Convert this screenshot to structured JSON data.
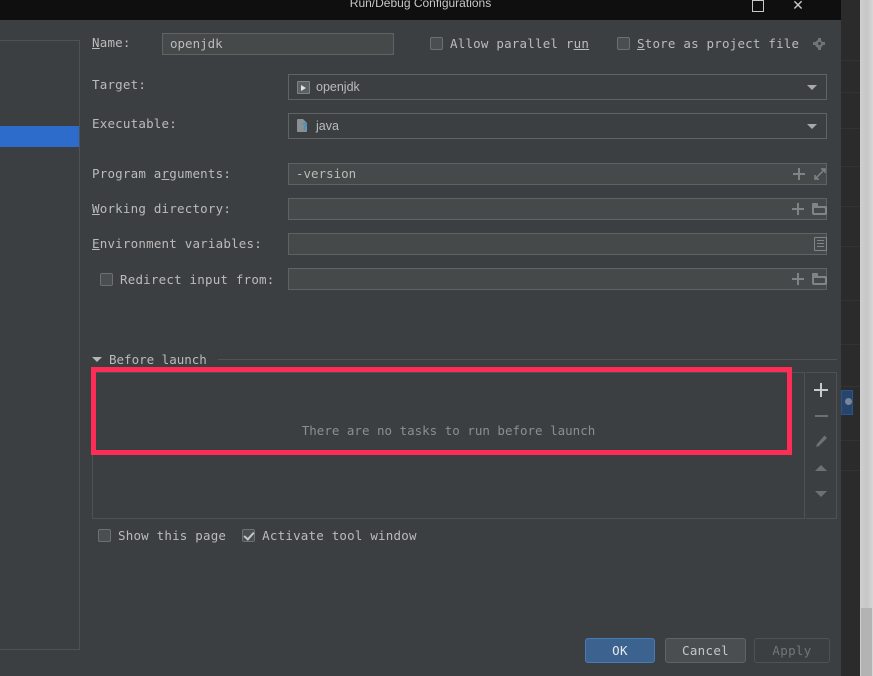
{
  "window": {
    "title": "Run/Debug Configurations",
    "maximize_label": "",
    "close_label": "✕"
  },
  "form": {
    "name": {
      "label": "Name:",
      "label_mnemonic": "N",
      "label_rest": "ame:",
      "value": "openjdk"
    },
    "allow_parallel_run": {
      "label_pre": "Allow parallel r",
      "label_mnemonic": "un",
      "label_post": "",
      "checked": false
    },
    "store_as_project_file": {
      "label_mnemonic": "S",
      "label_rest": "tore as project file",
      "checked": false
    },
    "target": {
      "label": "Target:",
      "value": "openjdk",
      "icon": "target-console-icon"
    },
    "executable": {
      "label": "Executable:",
      "value": "java",
      "icon": "file-unknown-icon"
    },
    "program_arguments": {
      "label_pre": "Program a",
      "label_mnemonic": "r",
      "label_post": "guments:",
      "value": "-version",
      "actions": [
        "plus-icon",
        "expand-icon"
      ]
    },
    "working_directory": {
      "label_mnemonic": "W",
      "label_rest": "orking directory:",
      "value": "",
      "actions": [
        "plus-icon",
        "folder-icon"
      ]
    },
    "environment_variables": {
      "label_mnemonic": "E",
      "label_rest": "nvironment variables:",
      "value": "",
      "actions": [
        "list-icon"
      ]
    },
    "redirect_input_from": {
      "label": "Redirect input from:",
      "checked": false,
      "value": "",
      "actions": [
        "plus-icon",
        "folder-icon"
      ]
    }
  },
  "before_launch": {
    "section_title": "Before launch",
    "empty_message": "There are no tasks to run before launch",
    "toolbar": {
      "add": "add-icon",
      "remove": "remove-icon",
      "edit": "edit-pencil-icon",
      "move_up": "move-up-icon",
      "move_down": "move-down-icon"
    }
  },
  "page_options": {
    "show_this_page": {
      "label": "Show this page",
      "checked": false
    },
    "activate_tool_window": {
      "label": "Activate tool window",
      "checked": true
    }
  },
  "footer": {
    "ok": "OK",
    "cancel": "Cancel",
    "apply": "Apply"
  },
  "colors": {
    "dialog_bg": "#3c3f41",
    "titlebar_bg": "#0f0f0f",
    "accent_blue": "#2d6cca",
    "ok_button": "#3c628f",
    "annotation_red": "#ff2d55",
    "field_bg": "#45494a",
    "text": "#bbbbbb"
  }
}
